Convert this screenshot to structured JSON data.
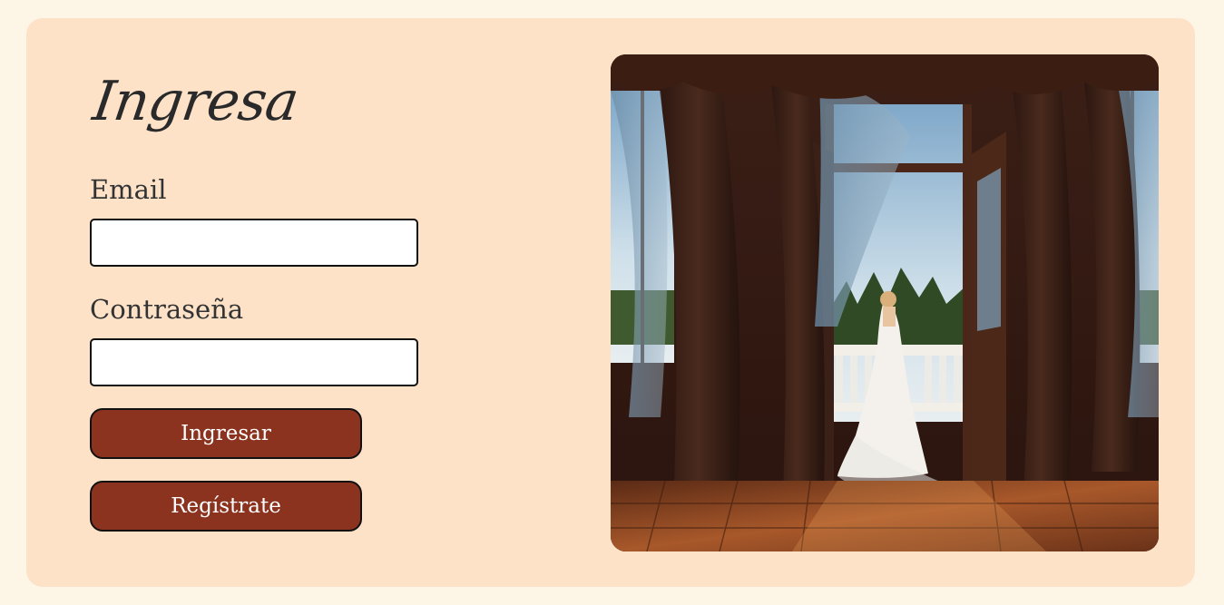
{
  "login": {
    "title": "Ingresa",
    "email_label": "Email",
    "email_value": "",
    "password_label": "Contraseña",
    "password_value": "",
    "login_button": "Ingresar",
    "register_button": "Regístrate"
  },
  "colors": {
    "page_bg": "#fdf5e6",
    "card_bg": "#fde2c8",
    "button_bg": "#8b331f",
    "button_text": "#ffffff"
  },
  "image": {
    "subject": "bride-at-balcony-doors-photo"
  }
}
